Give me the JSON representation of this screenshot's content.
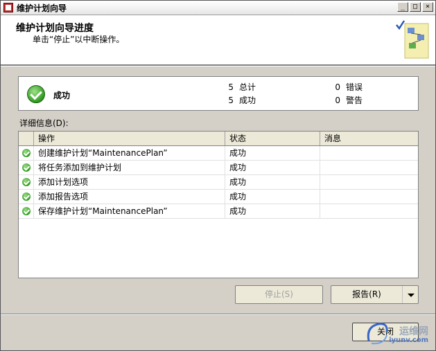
{
  "window": {
    "title": "维护计划向导",
    "controls": [
      "_",
      "□",
      "×"
    ]
  },
  "header": {
    "title": "维护计划向导进度",
    "subtitle": "单击“停止”以中断操作。"
  },
  "summary": {
    "status": "成功",
    "total_count": "5",
    "total_label": "总计",
    "success_count": "5",
    "success_label": "成功",
    "error_count": "0",
    "error_label": "错误",
    "warning_count": "0",
    "warning_label": "警告"
  },
  "details": {
    "label": "详细信息(D):",
    "columns": [
      "操作",
      "状态",
      "消息"
    ],
    "rows": [
      {
        "action": "创建维护计划“MaintenancePlan”",
        "status": "成功",
        "message": ""
      },
      {
        "action": "将任务添加到维护计划",
        "status": "成功",
        "message": ""
      },
      {
        "action": "添加计划选项",
        "status": "成功",
        "message": ""
      },
      {
        "action": "添加报告选项",
        "status": "成功",
        "message": ""
      },
      {
        "action": "保存维护计划“MaintenancePlan”",
        "status": "成功",
        "message": ""
      }
    ]
  },
  "buttons": {
    "stop": "停止(S)",
    "report": "报告(R)",
    "close": "关闭"
  },
  "watermark": {
    "text": "运维网",
    "sub": "iyunv.com"
  }
}
